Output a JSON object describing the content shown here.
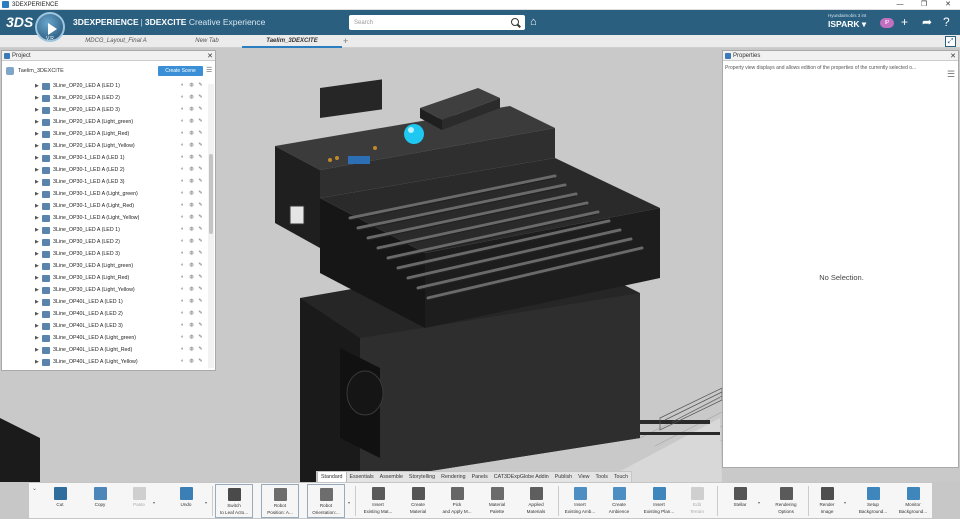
{
  "app": {
    "title": "3DEXPERIENCE"
  },
  "header": {
    "logo": "3DS",
    "compass_version": "V.R",
    "brand_bold": "3DEXPERIENCE",
    "brand_sep": "|",
    "brand_app": "3DEXCITE",
    "brand_suffix": "Creative Experience",
    "search_placeholder": "Search",
    "platform": "Hyundaimobis 3 int",
    "user": "ISPARK",
    "avatar_initials": "IP"
  },
  "tabs": [
    {
      "label": "MDCG_Layout_Final A"
    },
    {
      "label": "New Tab"
    },
    {
      "label": "Taelim_3DEXCITE"
    }
  ],
  "tab_add": "+",
  "project": {
    "panel_title": "Project",
    "root": "Taelim_3DEXCITE",
    "create_scene": "Create Scene",
    "items": [
      {
        "label": "3Line_OP20_LED A (LED 1)"
      },
      {
        "label": "3Line_OP20_LED A (LED 2)"
      },
      {
        "label": "3Line_OP20_LED A (LED 3)"
      },
      {
        "label": "3Line_OP20_LED A (Light_green)"
      },
      {
        "label": "3Line_OP20_LED A (Light_Red)"
      },
      {
        "label": "3Line_OP20_LED A (Light_Yellow)"
      },
      {
        "label": "3Line_OP30-1_LED A (LED 1)"
      },
      {
        "label": "3Line_OP30-1_LED A (LED 2)"
      },
      {
        "label": "3Line_OP30-1_LED A (LED 3)"
      },
      {
        "label": "3Line_OP30-1_LED A (Light_green)"
      },
      {
        "label": "3Line_OP30-1_LED A (Light_Red)"
      },
      {
        "label": "3Line_OP30-1_LED A (Light_Yellow)"
      },
      {
        "label": "3Line_OP30_LED A (LED 1)"
      },
      {
        "label": "3Line_OP30_LED A (LED 2)"
      },
      {
        "label": "3Line_OP30_LED A (LED 3)"
      },
      {
        "label": "3Line_OP30_LED A (Light_green)"
      },
      {
        "label": "3Line_OP30_LED A (Light_Red)"
      },
      {
        "label": "3Line_OP30_LED A (Light_Yellow)"
      },
      {
        "label": "3Line_OP40L_LED A (LED 1)"
      },
      {
        "label": "3Line_OP40L_LED A (LED 2)"
      },
      {
        "label": "3Line_OP40L_LED A (LED 3)"
      },
      {
        "label": "3Line_OP40L_LED A (Light_green)"
      },
      {
        "label": "3Line_OP40L_LED A (Light_Red)"
      },
      {
        "label": "3Line_OP40L_LED A (Light_Yellow)"
      }
    ]
  },
  "properties": {
    "panel_title": "Properties",
    "description": "Property view displays and allows edition of the properties of the currently selected o...",
    "empty": "No Selection."
  },
  "ribbon_tabs": [
    "Standard",
    "Essentials",
    "Assemble",
    "Storytelling",
    "Rendering",
    "Panels",
    "CAT3DExpGlobe Addin",
    "Publish",
    "View",
    "Tools",
    "Touch"
  ],
  "ribbon_active": "Standard",
  "ribbon": [
    {
      "line1": "Cut",
      "line2": ""
    },
    {
      "line1": "Copy",
      "line2": ""
    },
    {
      "line1": "Paste",
      "line2": ""
    },
    {
      "line1": "Undo",
      "line2": ""
    },
    {
      "line1": "Switch",
      "line2": "to Leaf Acto..."
    },
    {
      "line1": "Robot",
      "line2": "Position: A..."
    },
    {
      "line1": "Robot",
      "line2": "Orientation:..."
    },
    {
      "line1": "Insert",
      "line2": "Existing Mat..."
    },
    {
      "line1": "Create",
      "line2": "Material"
    },
    {
      "line1": "Pick",
      "line2": "and Apply M..."
    },
    {
      "line1": "Material",
      "line2": "Palette"
    },
    {
      "line1": "Applied",
      "line2": "Materials"
    },
    {
      "line1": "Insert",
      "line2": "Existing Amb..."
    },
    {
      "line1": "Create",
      "line2": "Ambience"
    },
    {
      "line1": "Insert",
      "line2": "Existing Plan..."
    },
    {
      "line1": "Edit",
      "line2": "Terrain"
    },
    {
      "line1": "Stellar",
      "line2": ""
    },
    {
      "line1": "Rendering",
      "line2": "Options"
    },
    {
      "line1": "Render",
      "line2": "Image"
    },
    {
      "line1": "Setup",
      "line2": "Background..."
    },
    {
      "line1": "Monitor",
      "line2": "Background..."
    }
  ],
  "colors": {
    "header": "#2a5f80",
    "accent": "#3a8fd6",
    "status_light": "#1ec8f0"
  }
}
